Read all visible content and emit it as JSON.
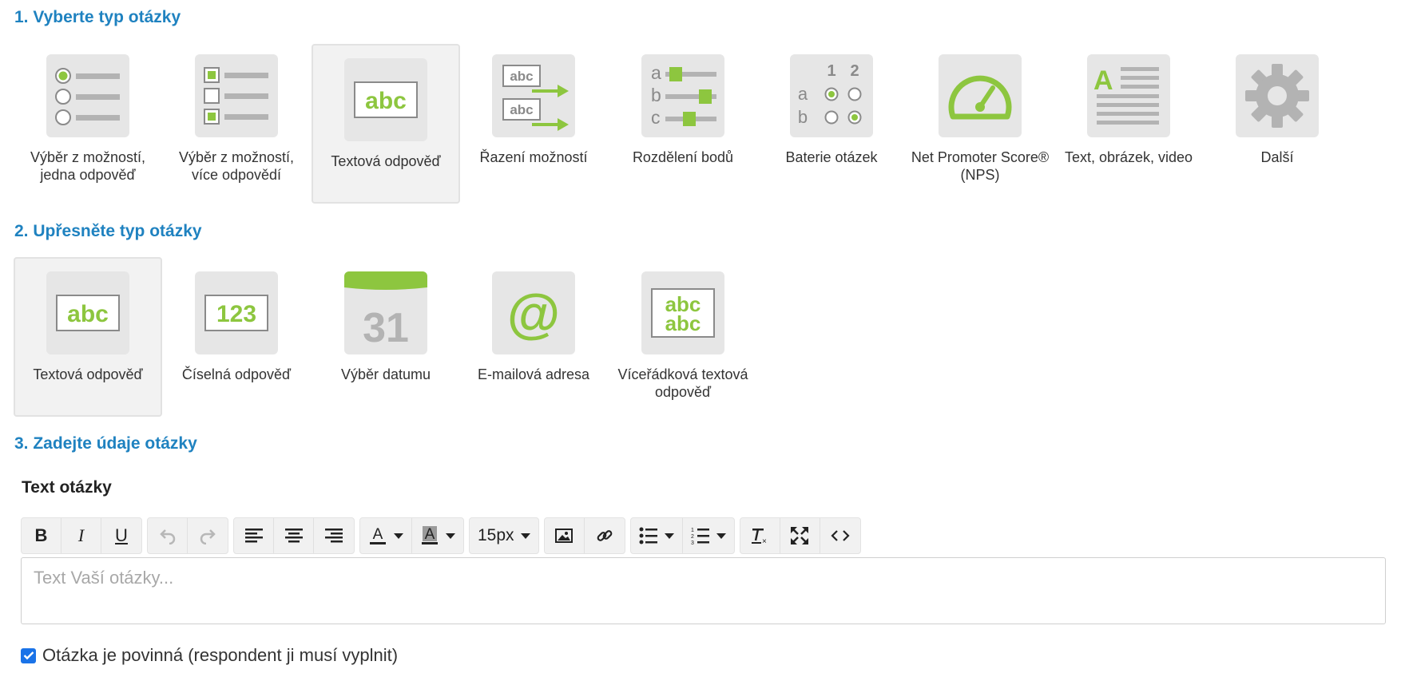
{
  "step1": {
    "title": "1. Vyberte typ otázky",
    "types": [
      {
        "label": "Výběr z možností, jedna odpověď",
        "icon": "single-choice-icon"
      },
      {
        "label": "Výběr z možností, více odpovědí",
        "icon": "multiple-choice-icon"
      },
      {
        "label": "Textová odpověď",
        "icon": "text-answer-icon",
        "selected": true
      },
      {
        "label": "Řazení možností",
        "icon": "ranking-icon"
      },
      {
        "label": "Rozdělení bodů",
        "icon": "points-distribution-icon"
      },
      {
        "label": "Baterie otázek",
        "icon": "question-matrix-icon"
      },
      {
        "label": "Net Promoter Score® (NPS)",
        "icon": "nps-gauge-icon"
      },
      {
        "label": "Text, obrázek, video",
        "icon": "text-image-video-icon"
      },
      {
        "label": "Další",
        "icon": "gear-icon"
      }
    ],
    "icon_text": {
      "abc": "abc",
      "letters": [
        "a",
        "b",
        "c"
      ],
      "matrix_cols": [
        "1",
        "2"
      ],
      "matrix_rows": [
        "a",
        "b"
      ],
      "doc_letter": "A"
    }
  },
  "step2": {
    "title": "2. Upřesněte typ otázky",
    "types": [
      {
        "label": "Textová odpověď",
        "icon": "text-answer-icon",
        "selected": true
      },
      {
        "label": "Číselná odpověď",
        "icon": "number-answer-icon"
      },
      {
        "label": "Výběr datumu",
        "icon": "calendar-icon"
      },
      {
        "label": "E-mailová adresa",
        "icon": "email-at-icon"
      },
      {
        "label": "Víceřádková textová odpověď",
        "icon": "multiline-text-icon"
      }
    ],
    "icon_text": {
      "abc": "abc",
      "number": "123",
      "date": "31",
      "at": "@",
      "multiline": [
        "abc",
        "abc"
      ]
    }
  },
  "step3": {
    "title": "3. Zadejte údaje otázky",
    "field_label": "Text otázky",
    "toolbar": {
      "bold": "B",
      "italic": "I",
      "underline": "U",
      "font_size": "15px"
    },
    "placeholder": "Text Vaší otázky...",
    "required_label": "Otázka je povinná (respondent ji musí vyplnit)",
    "required_checked": true
  },
  "colors": {
    "accent_blue": "#1f82c0",
    "icon_green": "#8dc63f",
    "icon_gray": "#b3b3b3",
    "icon_bg": "#e6e6e6"
  }
}
